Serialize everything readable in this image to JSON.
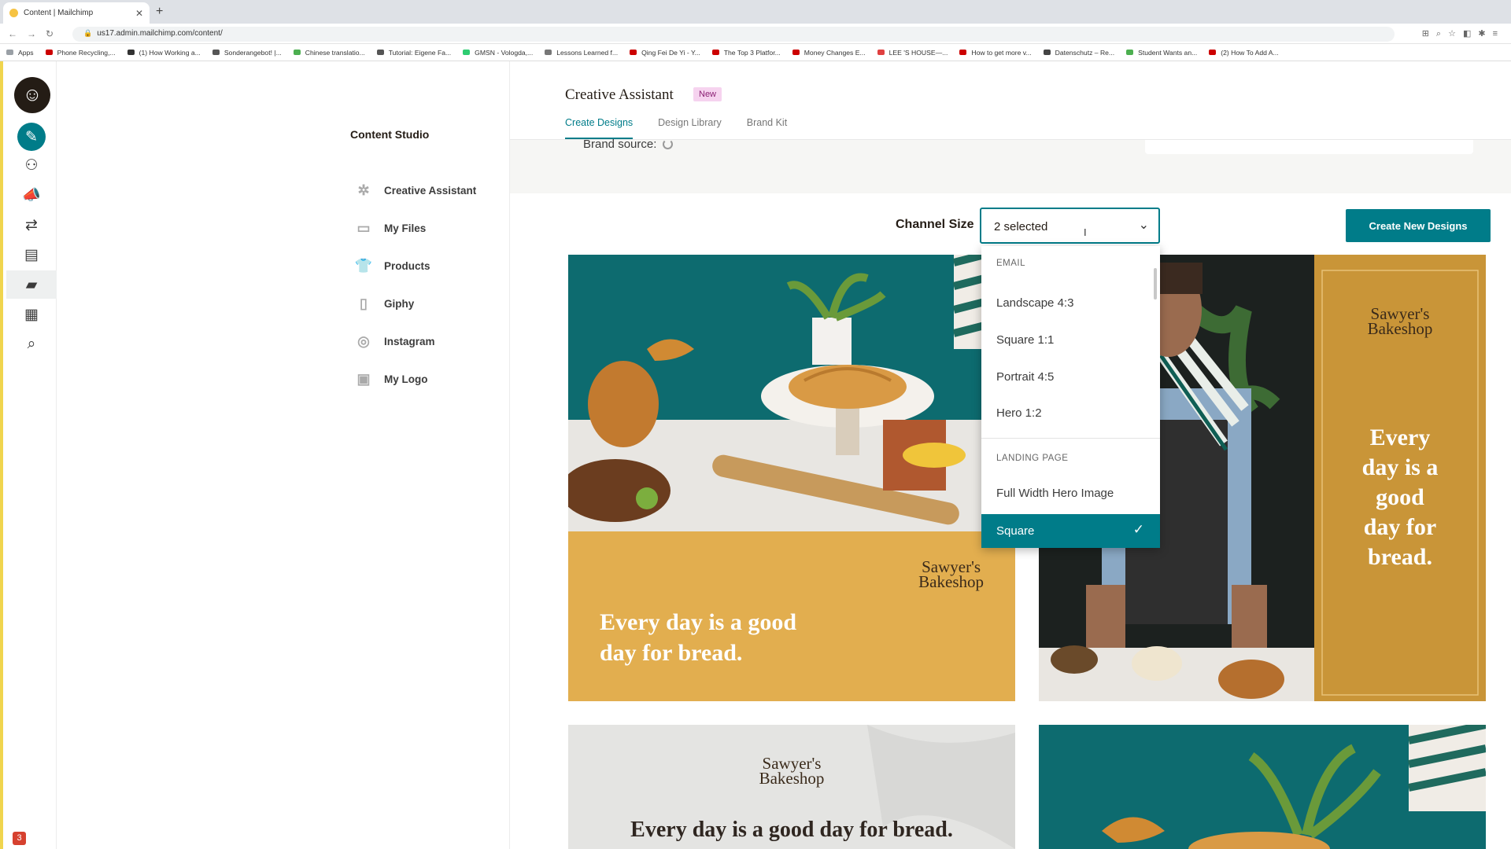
{
  "browser": {
    "tab_title": "Content | Mailchimp",
    "url": "us17.admin.mailchimp.com/content/",
    "bookmarks": [
      "Apps",
      "Phone Recycling,...",
      "(1) How Working a...",
      "Sonderangebot! |...",
      "Chinese translatio...",
      "Tutorial: Eigene Fa...",
      "GMSN - Vologda,...",
      "Lessons Learned f...",
      "Qing Fei De Yi - Y...",
      "The Top 3 Platfor...",
      "Money Changes E...",
      "LEE 'S HOUSE—...",
      "How to get more v...",
      "Datenschutz – Re...",
      "Student Wants an...",
      "(2) How To Add A..."
    ]
  },
  "rail": {
    "notification_count": "3"
  },
  "sidebar": {
    "title": "Content Studio",
    "items": [
      {
        "label": "Creative Assistant"
      },
      {
        "label": "My Files"
      },
      {
        "label": "Products"
      },
      {
        "label": "Giphy"
      },
      {
        "label": "Instagram"
      },
      {
        "label": "My Logo"
      }
    ]
  },
  "header": {
    "title": "Creative Assistant",
    "badge": "New",
    "tabs": [
      {
        "label": "Create Designs"
      },
      {
        "label": "Design Library"
      },
      {
        "label": "Brand Kit"
      }
    ]
  },
  "brand_source": "Brand source:",
  "channel_size": {
    "label": "Channel Size",
    "value": "2 selected",
    "dropdown": {
      "group_email": "EMAIL",
      "email_options": [
        "Landscape 4:3",
        "Square 1:1",
        "Portrait 4:5",
        "Hero 1:2"
      ],
      "group_landing": "LANDING PAGE",
      "landing_options": [
        "Full Width Hero Image",
        "Square"
      ]
    }
  },
  "create_button": "Create New Designs",
  "designs": {
    "brand_name_line1": "Sawyer's",
    "brand_name_line2": "Bakeshop",
    "tagline": "Every day is a good day for bread.",
    "tagline_split_1": "Every day is a good",
    "tagline_split_2": "day for bread.",
    "tagline_vertical": [
      "Every",
      "day is a",
      "good",
      "day for",
      "bread."
    ]
  },
  "colors": {
    "accent": "#007c89",
    "mustard": "#e2ae4f",
    "teal_bg": "#0d6b6f"
  }
}
